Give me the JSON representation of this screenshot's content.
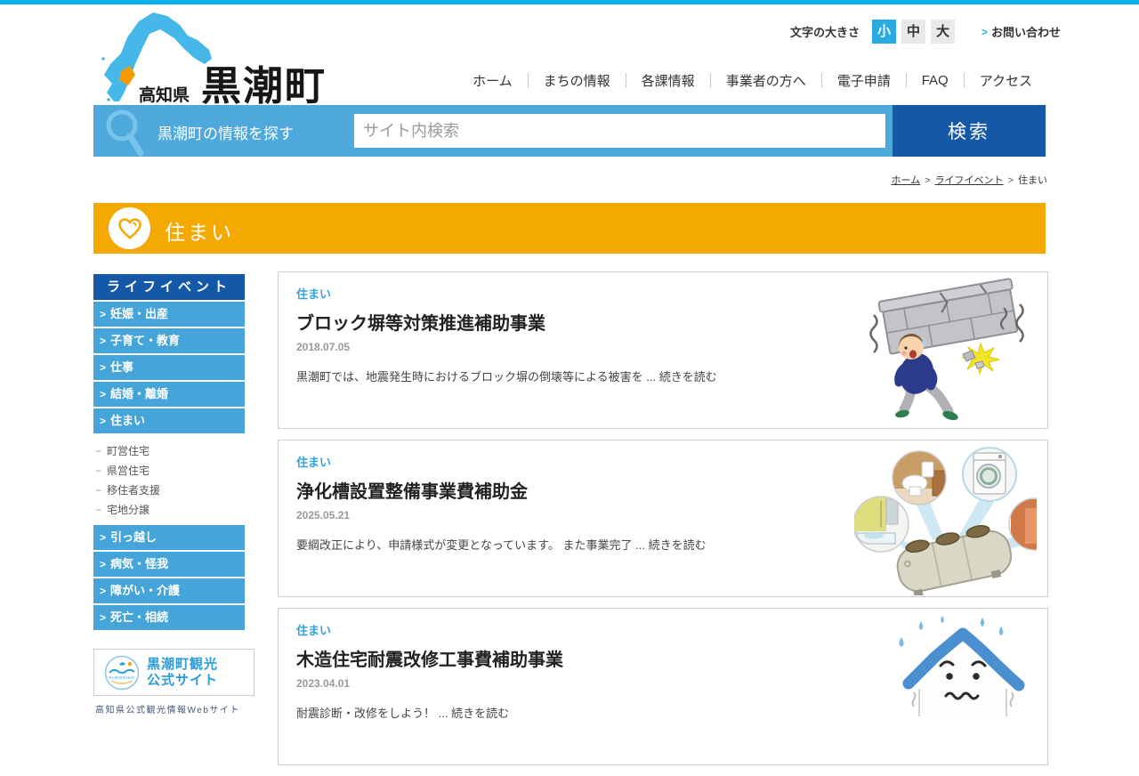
{
  "brand": {
    "prefecture": "高知県",
    "town": "黒潮町"
  },
  "header": {
    "font_size_label": "文字の大きさ",
    "font_size_options": [
      {
        "label": "小",
        "selected": true
      },
      {
        "label": "中",
        "selected": false
      },
      {
        "label": "大",
        "selected": false
      }
    ],
    "contact_label": "お問い合わせ",
    "nav": [
      "ホーム",
      "まちの情報",
      "各課情報",
      "事業者の方へ",
      "電子申請",
      "FAQ",
      "アクセス"
    ]
  },
  "search": {
    "lead": "黒潮町の情報を探す",
    "placeholder": "サイト内検索",
    "button": "検索"
  },
  "breadcrumb": {
    "items": [
      "ホーム",
      "ライフイベント",
      "住まい"
    ]
  },
  "banner": {
    "title": "住まい"
  },
  "sidebar": {
    "header": "ライフイベント",
    "items_top": [
      "妊娠・出産",
      "子育て・教育",
      "仕事",
      "結婚・離婚",
      "住まい"
    ],
    "sub_items": [
      "町営住宅",
      "県営住宅",
      "移住者支援",
      "宅地分譲"
    ],
    "items_bottom": [
      "引っ越し",
      "病気・怪我",
      "障がい・介護",
      "死亡・相続"
    ],
    "promo": {
      "line1": "黒潮町観光",
      "line2": "公式サイト",
      "logo_text": "KUROSHIO",
      "caption": "高知県公式観光情報Webサイト"
    }
  },
  "articles": [
    {
      "tag": "住まい",
      "title": "ブロック塀等対策推進補助事業",
      "date": "2018.07.05",
      "excerpt": "黒潮町では、地震発生時におけるブロック塀の倒壊等による被害を ...",
      "read_more": "続きを読む"
    },
    {
      "tag": "住まい",
      "title": "浄化槽設置整備事業費補助金",
      "date": "2025.05.21",
      "excerpt": "要綱改正により、申請様式が変更となっています。 また事業完了 ...",
      "read_more": "続きを読む"
    },
    {
      "tag": "住まい",
      "title": "木造住宅耐震改修工事費補助事業",
      "date": "2023.04.01",
      "excerpt": "耐震診断・改修をしよう！ ...",
      "read_more": "続きを読む"
    }
  ],
  "colors": {
    "top_strip": "#00b2e9",
    "primary_blue": "#1558a8",
    "sidebar_blue": "#45a4d8",
    "search_band_blue": "#4fa9dc",
    "accent_cyan": "#29abe2",
    "banner_orange": "#f4a900",
    "tag_blue": "#33a3dc",
    "map_blue": "#45b8e9",
    "map_town_orange": "#f59a00"
  }
}
